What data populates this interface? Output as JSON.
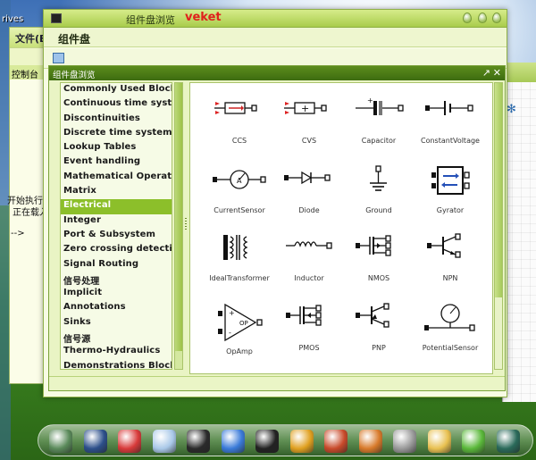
{
  "desktop": {
    "label_top_left": "rives",
    "console_texts": [
      "开始执行",
      "正在载入",
      "-->"
    ]
  },
  "console": {
    "menu_label": "文件(E)",
    "tab_label": "控制台"
  },
  "outer_window": {
    "title": "组件盘浏览",
    "brand": "veket",
    "heading": "组件盘"
  },
  "palette": {
    "title": "组件盘浏览",
    "pin_icon": "pin-icon",
    "close_icon": "close-icon",
    "categories": [
      "Commonly Used Blocks",
      "Continuous time systems",
      "Discontinuities",
      "Discrete time systems",
      "Lookup Tables",
      "Event handling",
      "Mathematical Operations",
      "Matrix",
      "Electrical",
      "Integer",
      "Port & Subsystem",
      "Zero crossing detection",
      "Signal Routing",
      "信号处理",
      "Implicit",
      "Annotations",
      "Sinks",
      "信号源",
      "Thermo-Hydraulics",
      "Demonstrations Blocks"
    ],
    "selected_category": "Electrical",
    "blocks": [
      {
        "label": "CCS",
        "icon": "ccs-icon"
      },
      {
        "label": "CVS",
        "icon": "cvs-icon"
      },
      {
        "label": "Capacitor",
        "icon": "capacitor-icon"
      },
      {
        "label": "ConstantVoltage",
        "icon": "constant-voltage-icon"
      },
      {
        "label": "CurrentSensor",
        "icon": "current-sensor-icon"
      },
      {
        "label": "Diode",
        "icon": "diode-icon"
      },
      {
        "label": "Ground",
        "icon": "ground-icon"
      },
      {
        "label": "Gyrator",
        "icon": "gyrator-icon"
      },
      {
        "label": "IdealTransformer",
        "icon": "transformer-icon"
      },
      {
        "label": "Inductor",
        "icon": "inductor-icon"
      },
      {
        "label": "NMOS",
        "icon": "nmos-icon"
      },
      {
        "label": "NPN",
        "icon": "npn-icon"
      },
      {
        "label": "OpAmp",
        "icon": "opamp-icon"
      },
      {
        "label": "PMOS",
        "icon": "pmos-icon"
      },
      {
        "label": "PNP",
        "icon": "pnp-icon"
      },
      {
        "label": "PotentialSensor",
        "icon": "potential-sensor-icon"
      }
    ]
  },
  "dock": {
    "items": [
      "chart-app-icon",
      "monitor-app-icon",
      "dragon-app-icon",
      "paper-app-icon",
      "media-app-icon",
      "chat-app-icon",
      "penguin-app-icon",
      "folder-app-icon",
      "presentation-app-icon",
      "paint-app-icon",
      "pen-app-icon",
      "document-app-icon",
      "help-app-icon",
      "camera-app-icon"
    ]
  }
}
